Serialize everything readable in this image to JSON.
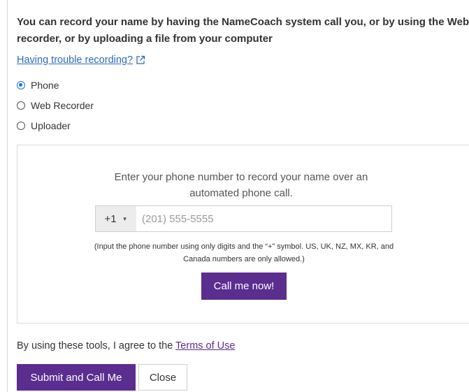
{
  "heading": "You can record your name by having the NameCoach system call you, or by using the Web recorder, or by uploading a file from your computer",
  "trouble_link": "Having trouble recording?",
  "recording_options": [
    {
      "label": "Phone",
      "checked": true
    },
    {
      "label": "Web Recorder",
      "checked": false
    },
    {
      "label": "Uploader",
      "checked": false
    }
  ],
  "phone_panel": {
    "instructions": "Enter your phone number to record your name over an automated phone call.",
    "country_code": "+1",
    "phone_placeholder": "(201) 555-5555",
    "phone_value": "",
    "hint": "(Input the phone number using only digits and the “+” symbol. US, UK, NZ, MX, KR, and Canada numbers are only allowed.)",
    "call_button": "Call me now!"
  },
  "terms": {
    "prefix": "By using these tools, I agree to the ",
    "link": "Terms of Use"
  },
  "footer": {
    "submit_button": "Submit and Call Me",
    "close_button": "Close"
  },
  "colors": {
    "accent": "#5b2d8f",
    "link": "#2d6bb8",
    "radio_selected": "#1a73e8"
  }
}
